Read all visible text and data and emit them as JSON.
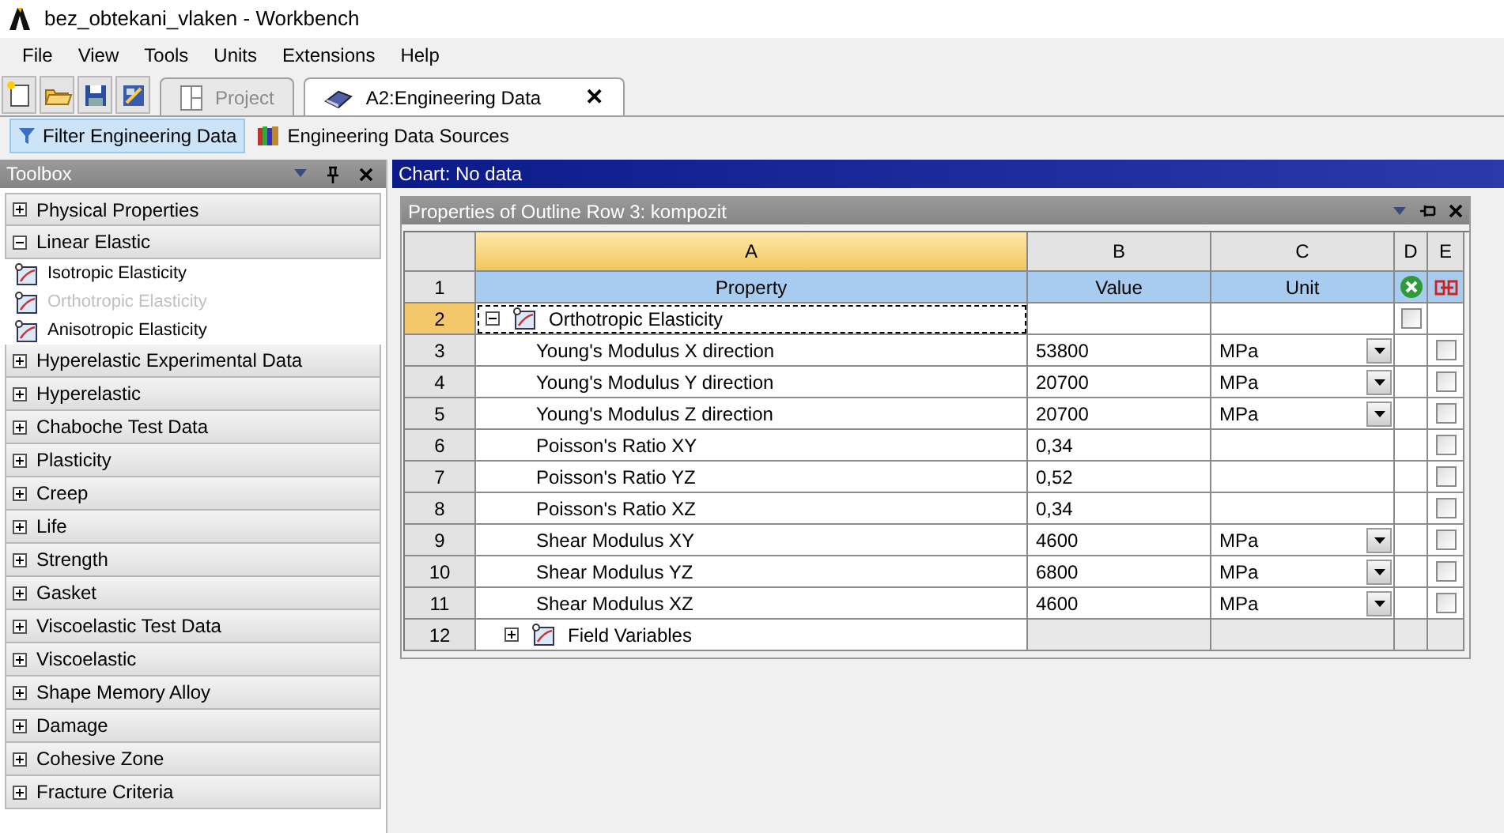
{
  "window": {
    "title": "bez_obtekani_vlaken - Workbench"
  },
  "menu": [
    "File",
    "View",
    "Tools",
    "Units",
    "Extensions",
    "Help"
  ],
  "tabs": [
    {
      "label": "Project",
      "selected": false,
      "closable": false
    },
    {
      "label": "A2:Engineering Data",
      "selected": true,
      "closable": true
    }
  ],
  "close_glyph": "✕",
  "subtoolbar": [
    {
      "label": "Filter Engineering Data",
      "selected": true
    },
    {
      "label": "Engineering Data Sources",
      "selected": false
    }
  ],
  "toolbox": {
    "title": "Toolbox",
    "categories": [
      {
        "label": "Physical Properties",
        "expanded": false
      },
      {
        "label": "Linear Elastic",
        "expanded": true,
        "children": [
          {
            "label": "Isotropic Elasticity",
            "disabled": false
          },
          {
            "label": "Orthotropic Elasticity",
            "disabled": true
          },
          {
            "label": "Anisotropic Elasticity",
            "disabled": false
          }
        ]
      },
      {
        "label": "Hyperelastic Experimental Data",
        "expanded": false
      },
      {
        "label": "Hyperelastic",
        "expanded": false
      },
      {
        "label": "Chaboche Test Data",
        "expanded": false
      },
      {
        "label": "Plasticity",
        "expanded": false
      },
      {
        "label": "Creep",
        "expanded": false
      },
      {
        "label": "Life",
        "expanded": false
      },
      {
        "label": "Strength",
        "expanded": false
      },
      {
        "label": "Gasket",
        "expanded": false
      },
      {
        "label": "Viscoelastic Test Data",
        "expanded": false
      },
      {
        "label": "Viscoelastic",
        "expanded": false
      },
      {
        "label": "Shape Memory Alloy",
        "expanded": false
      },
      {
        "label": "Damage",
        "expanded": false
      },
      {
        "label": "Cohesive Zone",
        "expanded": false
      },
      {
        "label": "Fracture Criteria",
        "expanded": false
      }
    ]
  },
  "chart": {
    "title": "Chart: No data"
  },
  "properties": {
    "title": "Properties of Outline Row 3: kompozit",
    "column_letters": [
      "A",
      "B",
      "C",
      "D",
      "E"
    ],
    "header_row": {
      "number": "1",
      "labels": [
        "Property",
        "Value",
        "Unit"
      ]
    },
    "rows": [
      {
        "number": "2",
        "kind": "group",
        "expanded": true,
        "selected": true,
        "property": "Orthotropic Elasticity",
        "d_checked": false
      },
      {
        "number": "3",
        "kind": "property",
        "selected": false,
        "property": "Young's Modulus X direction",
        "value": "53800",
        "unit": "MPa",
        "e_checked": false
      },
      {
        "number": "4",
        "kind": "property",
        "selected": false,
        "property": "Young's Modulus Y direction",
        "value": "20700",
        "unit": "MPa",
        "e_checked": false
      },
      {
        "number": "5",
        "kind": "property",
        "selected": false,
        "property": "Young's Modulus Z direction",
        "value": "20700",
        "unit": "MPa",
        "e_checked": false
      },
      {
        "number": "6",
        "kind": "property",
        "selected": false,
        "property": "Poisson's Ratio XY",
        "value": "0,34",
        "e_checked": false
      },
      {
        "number": "7",
        "kind": "property",
        "selected": false,
        "property": "Poisson's Ratio YZ",
        "value": "0,52",
        "e_checked": false
      },
      {
        "number": "8",
        "kind": "property",
        "selected": false,
        "property": "Poisson's Ratio XZ",
        "value": "0,34",
        "e_checked": false
      },
      {
        "number": "9",
        "kind": "property",
        "selected": false,
        "property": "Shear Modulus XY",
        "value": "4600",
        "unit": "MPa",
        "e_checked": false
      },
      {
        "number": "10",
        "kind": "property",
        "selected": false,
        "property": "Shear Modulus YZ",
        "value": "6800",
        "unit": "MPa",
        "e_checked": false
      },
      {
        "number": "11",
        "kind": "property",
        "selected": false,
        "property": "Shear Modulus XZ",
        "value": "4600",
        "unit": "MPa",
        "e_checked": false
      },
      {
        "number": "12",
        "kind": "group",
        "expanded": false,
        "selected": false,
        "property": "Field Variables"
      }
    ]
  }
}
